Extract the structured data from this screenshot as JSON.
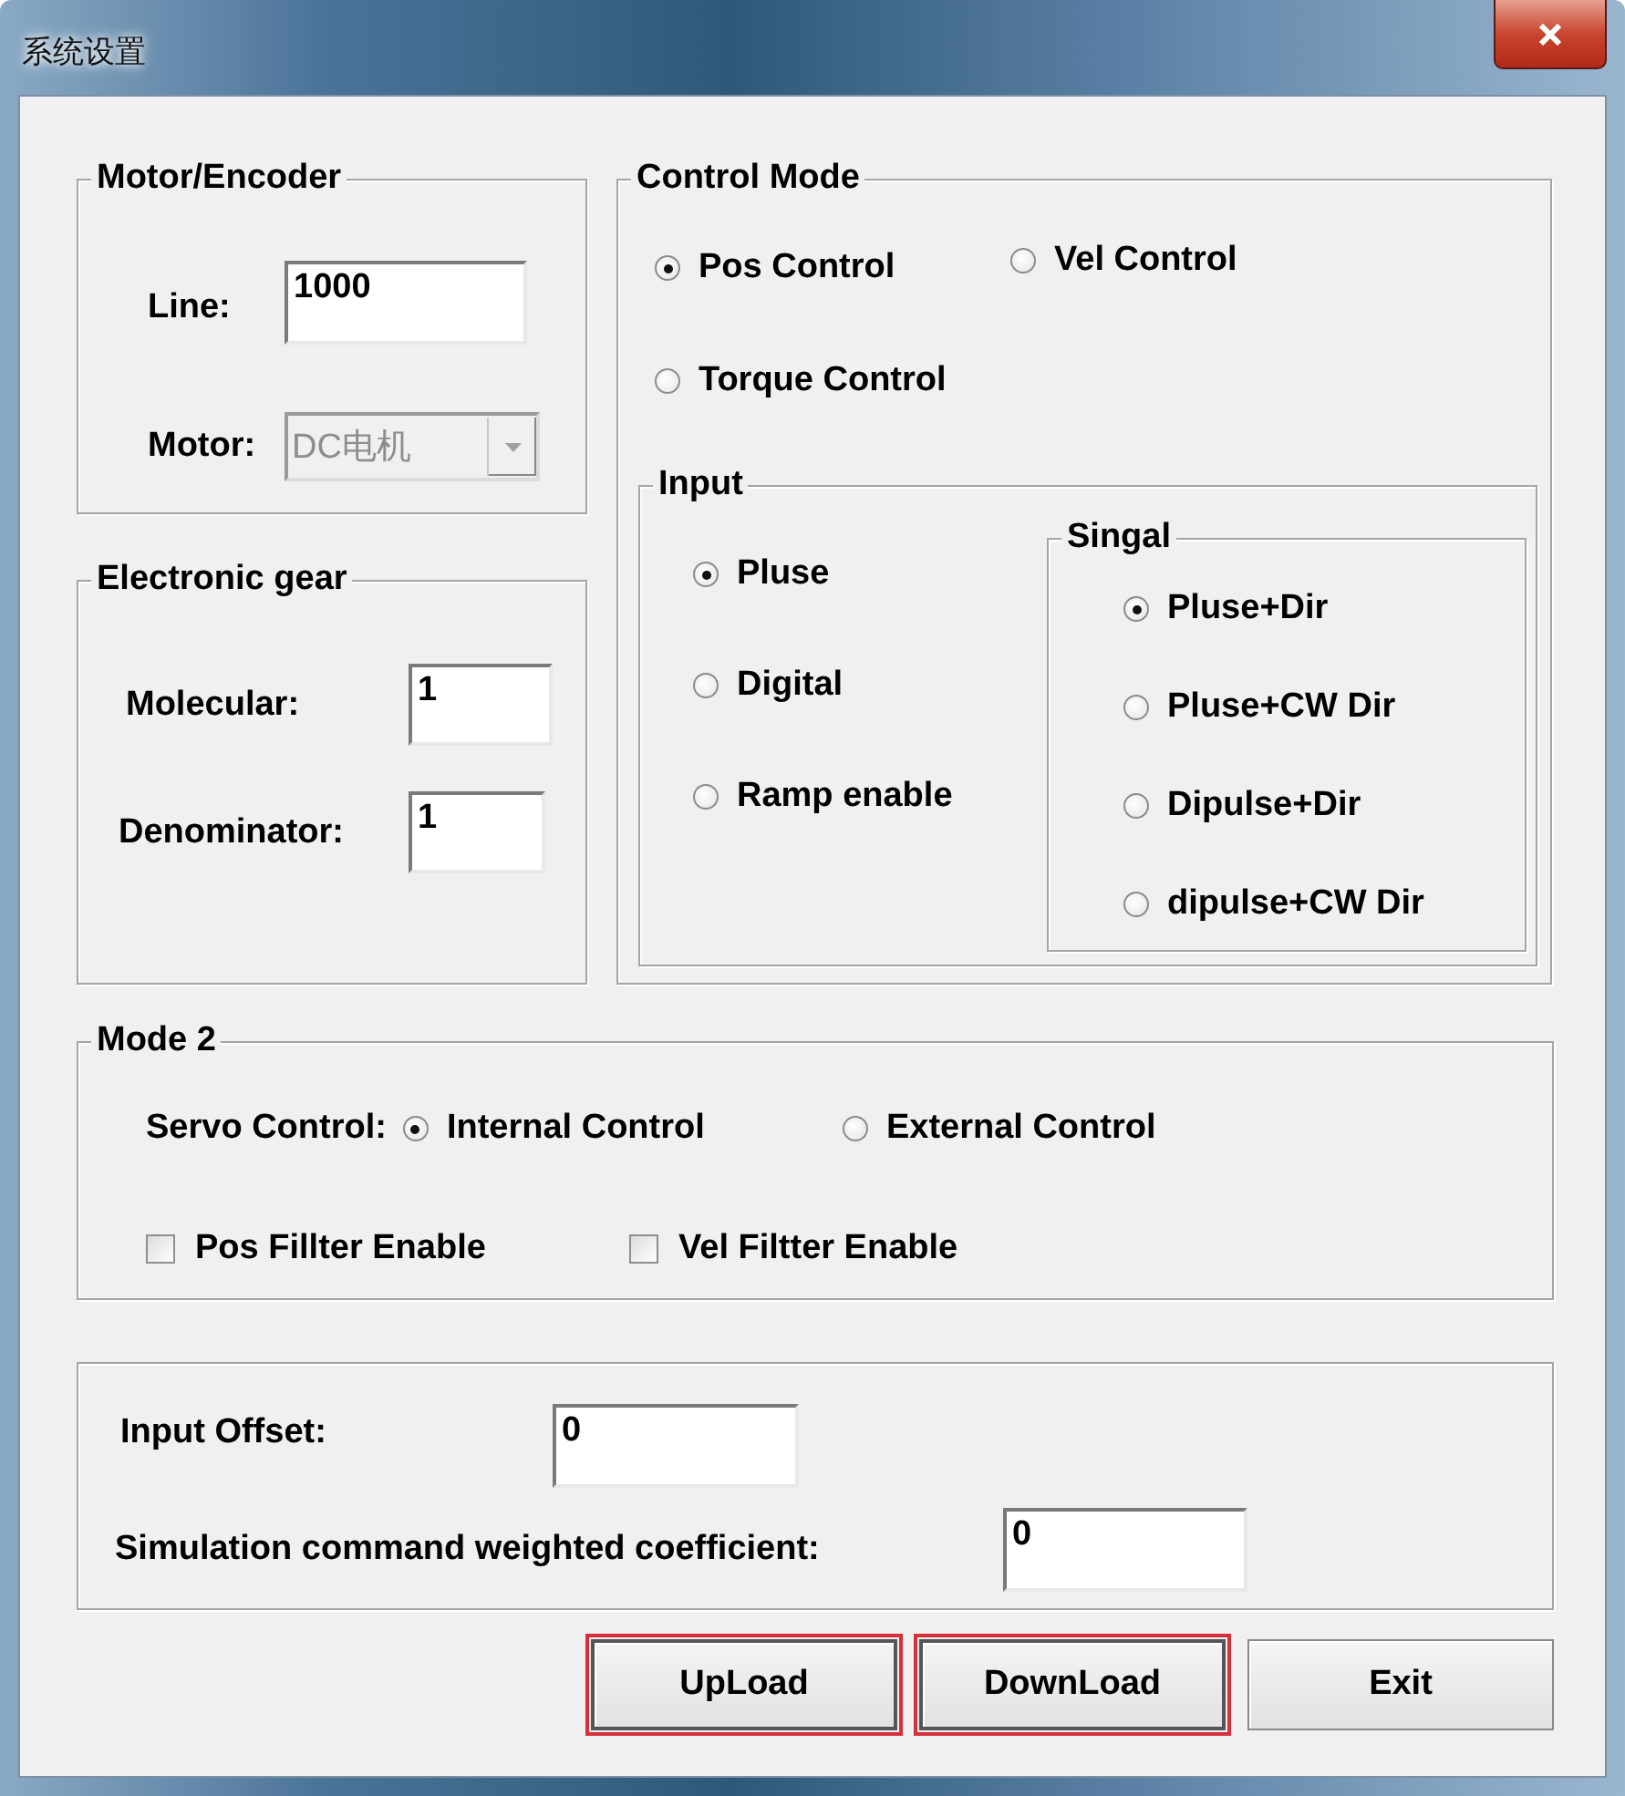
{
  "window": {
    "title": "系统设置"
  },
  "motor_encoder": {
    "title": "Motor/Encoder",
    "line": {
      "label": "Line:",
      "value": "1000"
    },
    "motor": {
      "label": "Motor:",
      "value": "DC电机",
      "disabled": true
    }
  },
  "electronic_gear": {
    "title": "Electronic gear",
    "molecular": {
      "label": "Molecular:",
      "value": "1"
    },
    "denominator": {
      "label": "Denominator:",
      "value": "1"
    }
  },
  "control_mode": {
    "title": "Control Mode",
    "options": [
      {
        "label": "Pos Control",
        "selected": true
      },
      {
        "label": "Vel Control",
        "selected": false
      },
      {
        "label": "Torque Control",
        "selected": false
      }
    ],
    "input": {
      "title": "Input",
      "options": [
        {
          "label": "Pluse",
          "selected": true
        },
        {
          "label": "Digital",
          "selected": false
        },
        {
          "label": "Ramp enable",
          "selected": false
        }
      ]
    },
    "signal": {
      "title": "Singal",
      "options": [
        {
          "label": "Pluse+Dir",
          "selected": true
        },
        {
          "label": "Pluse+CW Dir",
          "selected": false
        },
        {
          "label": "Dipulse+Dir",
          "selected": false
        },
        {
          "label": "dipulse+CW Dir",
          "selected": false
        }
      ]
    }
  },
  "mode_2": {
    "title": "Mode 2",
    "servo_control": {
      "label": "Servo Control:",
      "options": [
        {
          "label": "Internal Control",
          "selected": true
        },
        {
          "label": "External Control",
          "selected": false
        }
      ]
    },
    "checkboxes": [
      {
        "label": "Pos Fillter Enable",
        "checked": false
      },
      {
        "label": "Vel Filtter Enable",
        "checked": false
      }
    ]
  },
  "offsets": {
    "input_offset": {
      "label": "Input Offset:",
      "value": "0"
    },
    "simulation_coefficient": {
      "label": "Simulation command weighted coefficient:",
      "value": "0"
    }
  },
  "buttons": [
    {
      "label": "UpLoad",
      "highlighted": true
    },
    {
      "label": "DownLoad",
      "highlighted": true
    },
    {
      "label": "Exit",
      "highlighted": false
    }
  ]
}
